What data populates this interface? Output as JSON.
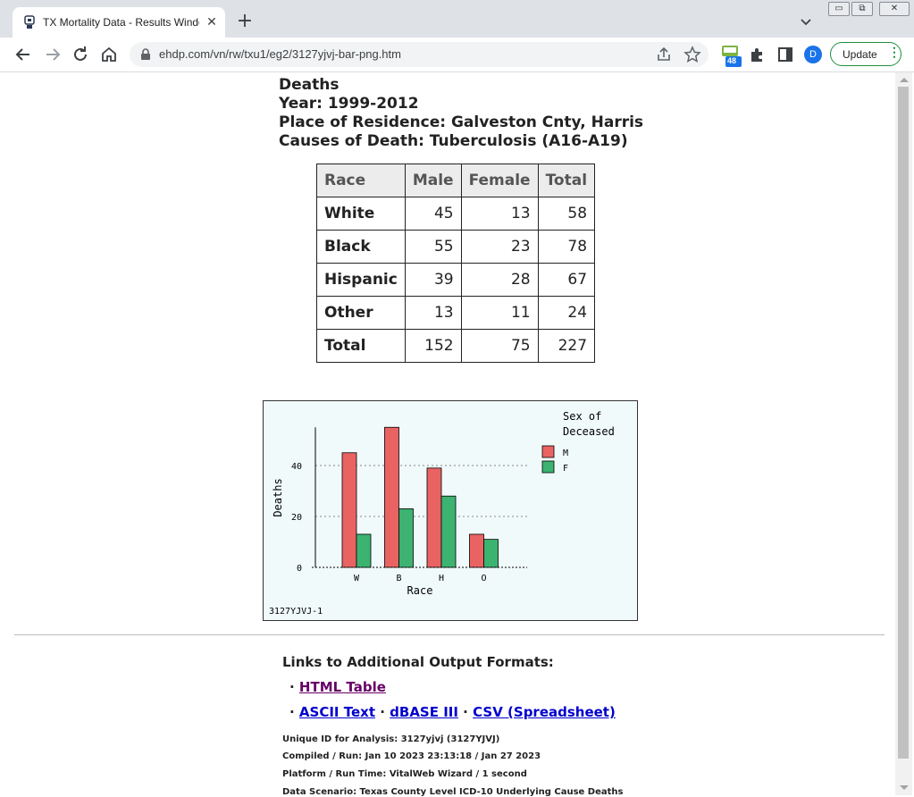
{
  "browser": {
    "tab_title": "TX Mortality Data - Results Window",
    "url": "ehdp.com/vn/rw/txu1/eg2/3127yjvj-bar-png.htm",
    "extension_badge": "48",
    "avatar_initial": "D",
    "update_label": "Update",
    "icons": [
      "back-icon",
      "forward-icon",
      "reload-icon",
      "home-icon",
      "lock-icon",
      "share-icon",
      "star-icon",
      "puzzle-icon",
      "sidepanel-icon"
    ]
  },
  "report": {
    "title": "Deaths",
    "year": "Year: 1999-2012",
    "place": "Place of Residence: Galveston Cnty, Harris",
    "causes": "Causes of Death: Tuberculosis (A16-A19)"
  },
  "table": {
    "headers": [
      "Race",
      "Male",
      "Female",
      "Total"
    ],
    "rows": [
      [
        "White",
        "45",
        "13",
        "58"
      ],
      [
        "Black",
        "55",
        "23",
        "78"
      ],
      [
        "Hispanic",
        "39",
        "28",
        "67"
      ],
      [
        "Other",
        "13",
        "11",
        "24"
      ],
      [
        "Total",
        "152",
        "75",
        "227"
      ]
    ]
  },
  "chart_data": {
    "type": "bar",
    "categories": [
      "W",
      "B",
      "H",
      "O"
    ],
    "series": [
      {
        "name": "M",
        "values": [
          45,
          55,
          39,
          13
        ],
        "color": "#e96363"
      },
      {
        "name": "F",
        "values": [
          13,
          23,
          28,
          11
        ],
        "color": "#3cb371"
      }
    ],
    "xlabel": "Race",
    "ylabel": "Deaths",
    "yticks": [
      0,
      20,
      40
    ],
    "ylim": [
      0,
      55
    ],
    "legend_title_line1": "Sex of",
    "legend_title_line2": "Deceased",
    "legend_placement": "top-right",
    "grid": "dotted horizontal at 20 and 40",
    "footer_id": "3127YJVJ-1",
    "background": "#f0fafa"
  },
  "links": {
    "title": "Links to Additional Output Formats:",
    "html_table": "HTML Table",
    "ascii": "ASCII Text",
    "dbase": "dBASE III",
    "csv": "CSV (Spreadsheet)"
  },
  "meta": {
    "unique_id": "Unique ID for Analysis: 3127yjvj (3127YJVJ)",
    "compiled": "Compiled / Run: Jan 10 2023 23:13:18 / Jan 27 2023",
    "platform": "Platform / Run Time: VitalWeb Wizard / 1 second",
    "scenario": "Data Scenario: Texas County Level ICD-10 Underlying Cause Deaths"
  }
}
